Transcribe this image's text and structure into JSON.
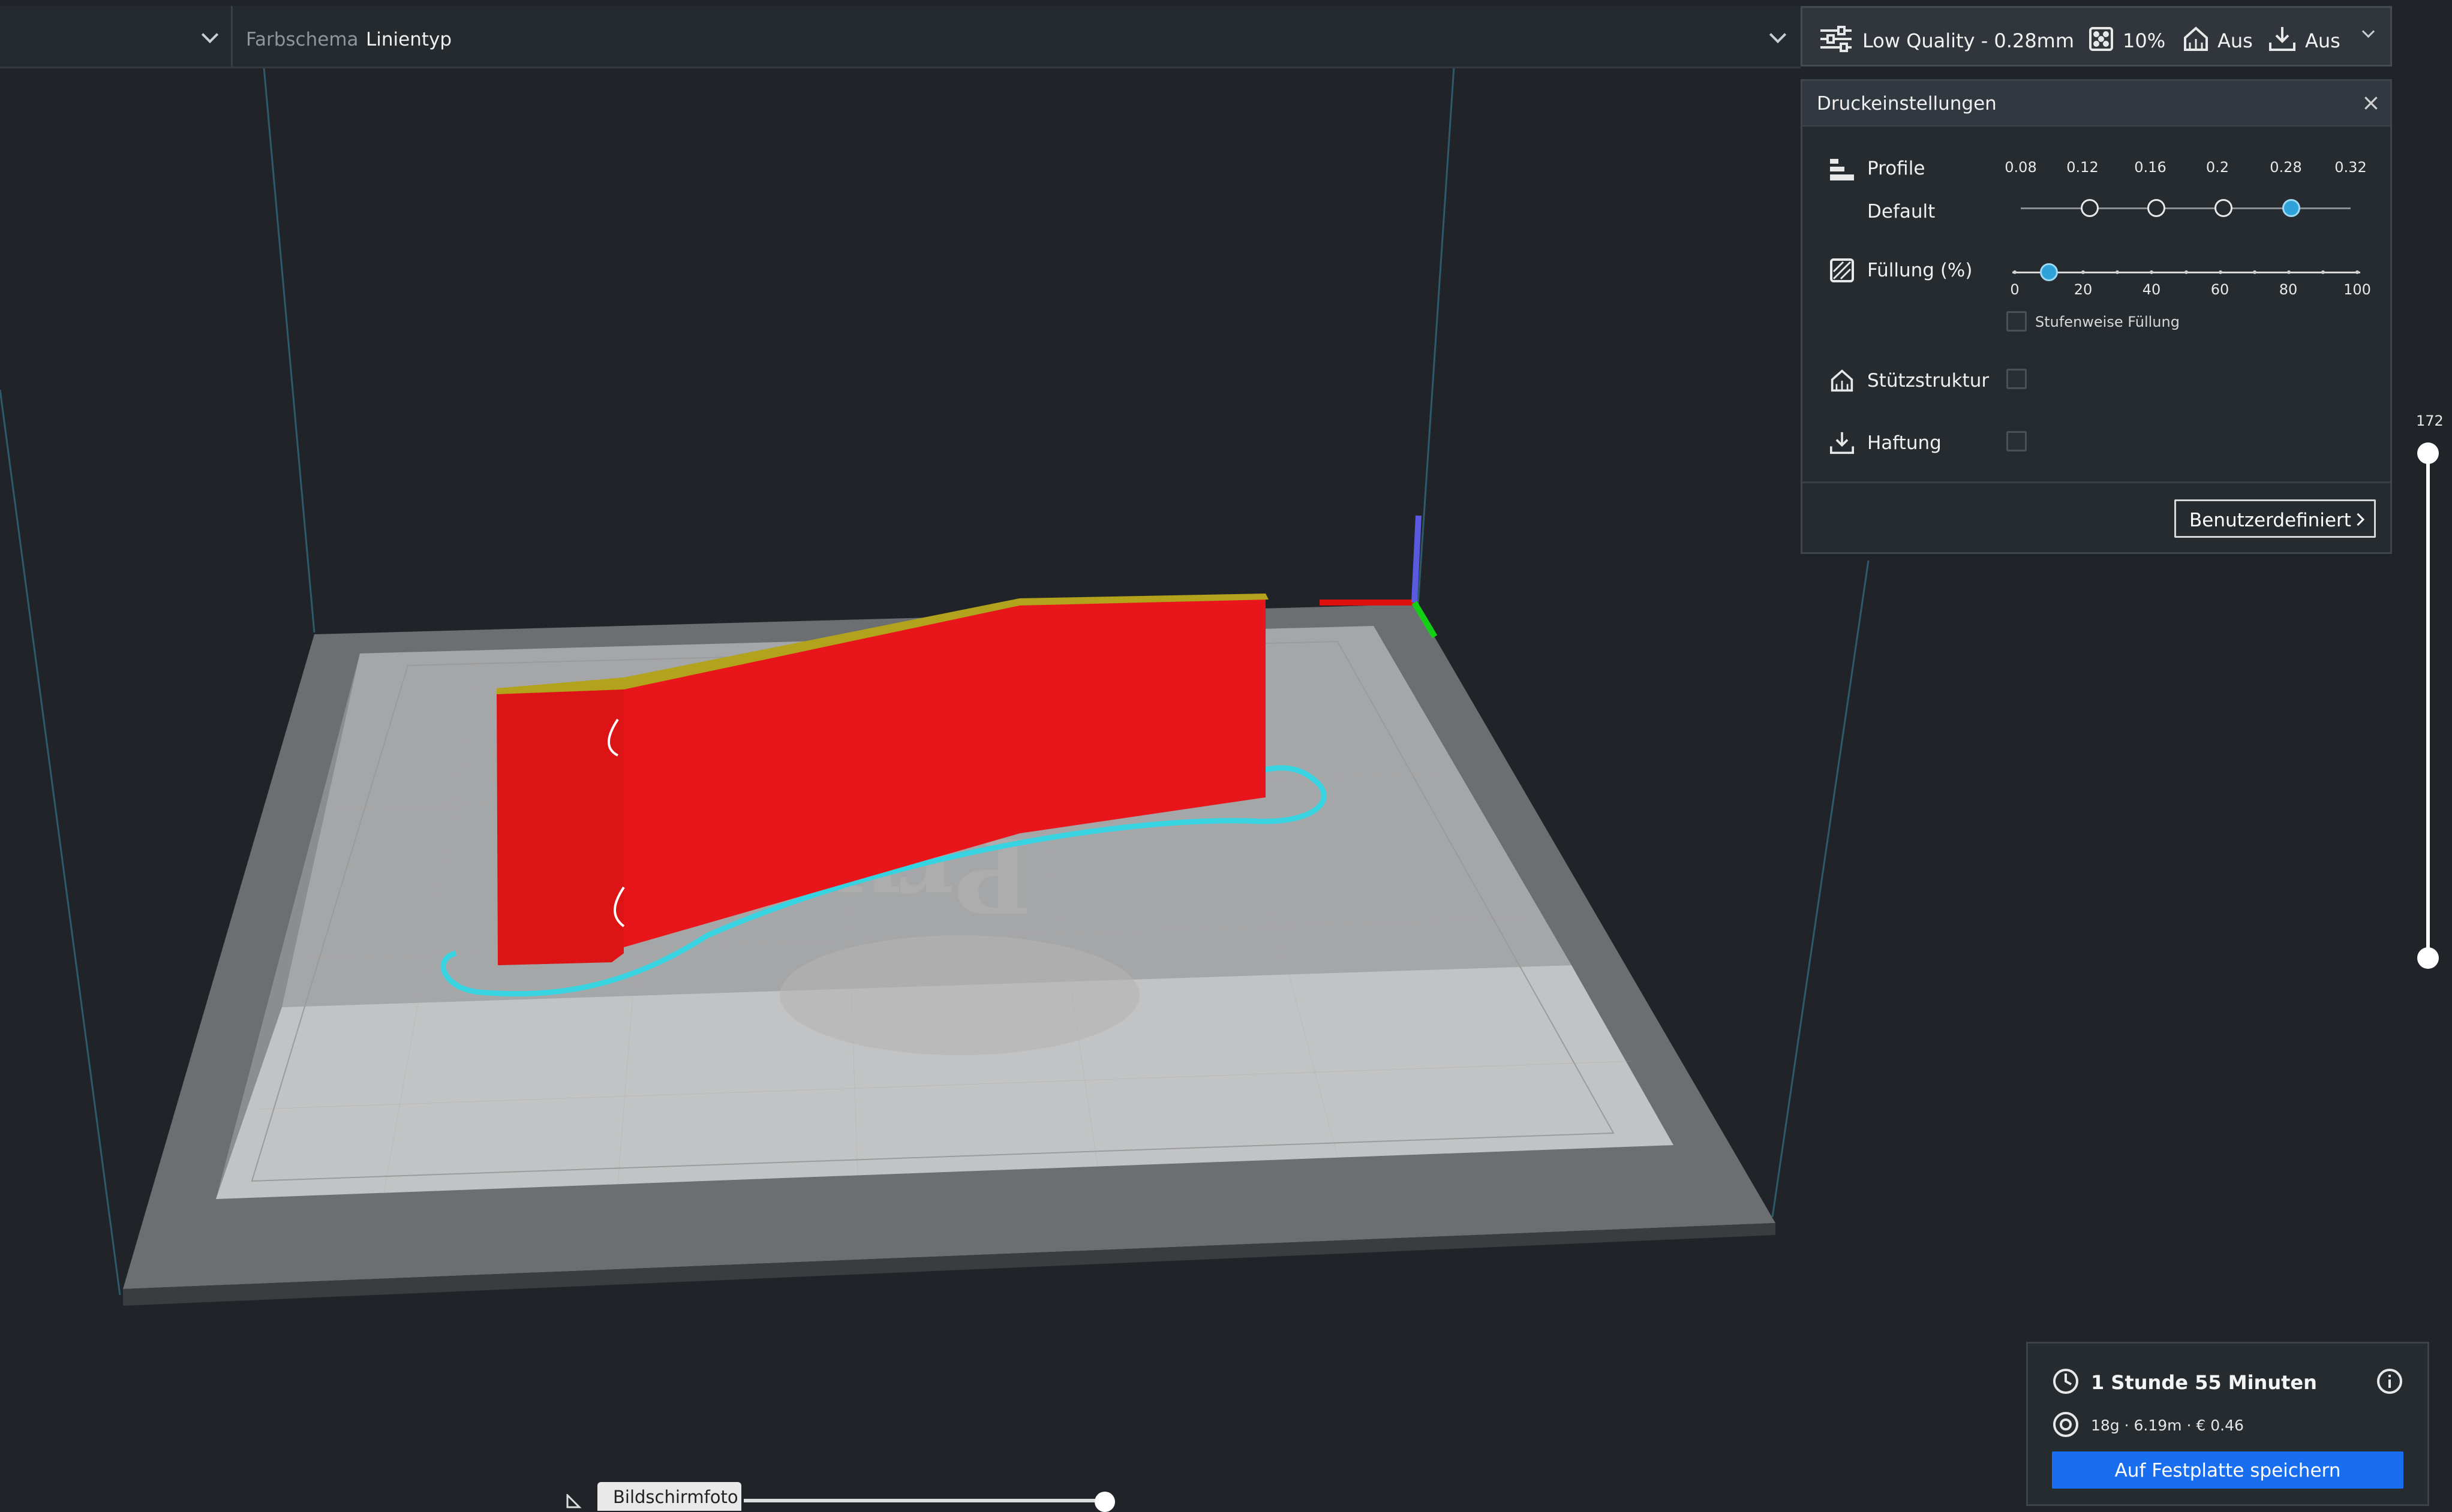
{
  "topbar": {
    "color_scheme_label": "Farbschema",
    "color_scheme_value": "Linientyp"
  },
  "quickbar": {
    "profile": "Low Quality - 0.28mm",
    "infill": "10%",
    "support": "Aus",
    "adhesion": "Aus"
  },
  "panel": {
    "title": "Druckeinstellungen",
    "close": "×",
    "profile_label": "Profile",
    "profile_default": "Default",
    "layer_heights": [
      "0.08",
      "0.12",
      "0.16",
      "0.2",
      "0.28",
      "0.32"
    ],
    "layer_height_selected": "0.28",
    "infill_label": "Füllung (%)",
    "infill_ticks": [
      "0",
      "20",
      "40",
      "60",
      "80",
      "100"
    ],
    "infill_value": 10,
    "gradual_infill_label": "Stufenweise Füllung",
    "support_label": "Stützstruktur",
    "adhesion_label": "Haftung",
    "custom_button": "Benutzerdefiniert"
  },
  "layer_slider": {
    "current_layer": "172"
  },
  "print_info": {
    "time": "1 Stunde 55 Minuten",
    "stats": "18g · 6.19m · € 0.46",
    "save_button": "Auf Festplatte speichern"
  },
  "screenshot_chip": {
    "label": "Bildschirmfoto"
  },
  "colors": {
    "accent": "#196ef0",
    "slider_selected": "#2fa3d9",
    "model_red": "#e8161a",
    "travel_cyan": "#38d3e0",
    "build_plate": "#b9b9b9"
  }
}
